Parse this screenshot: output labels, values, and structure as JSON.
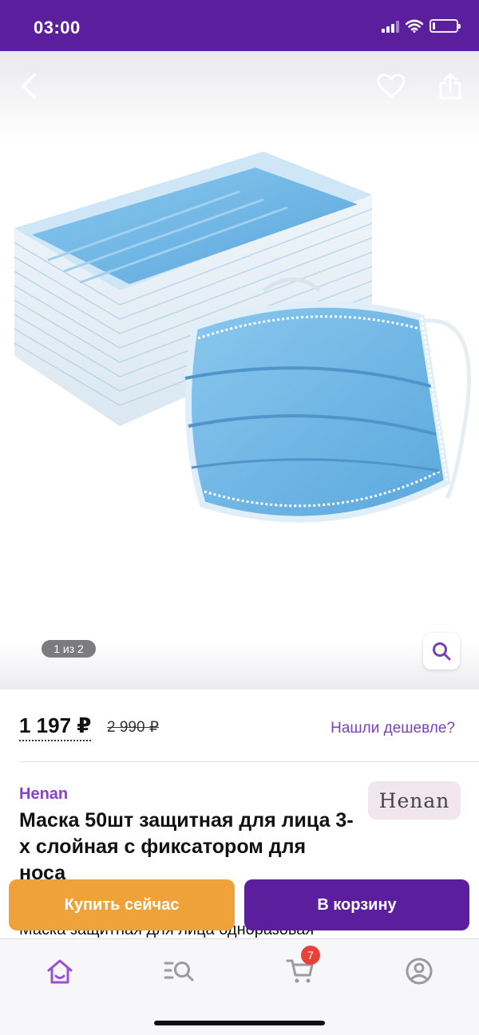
{
  "status_bar": {
    "time": "03:00",
    "battery_level": 0.1
  },
  "gallery": {
    "counter": "1 из 2",
    "image": "disposable-face-masks-photo"
  },
  "price": {
    "current": "1 197 ₽",
    "old": "2 990 ₽",
    "cheaper_link": "Нашли дешевле?"
  },
  "product": {
    "brand": "Henan",
    "brand_logo_text": "Henan",
    "title": "Маска 50шт защитная для лица 3-х слойная с фиксатором для носа",
    "subtitle": "Маска защитная для лица одноразовая"
  },
  "actions": {
    "buy_now": "Купить сейчас",
    "add_to_cart": "В корзину"
  },
  "tab_bar": {
    "cart_badge": "7",
    "icons": [
      "home-icon",
      "catalog-search-icon",
      "cart-icon",
      "profile-icon"
    ]
  },
  "colors": {
    "brand_purple": "#5b1f9e",
    "accent_purple": "#8a3fcf",
    "orange": "#f0a23a",
    "badge_red": "#e8413a"
  }
}
